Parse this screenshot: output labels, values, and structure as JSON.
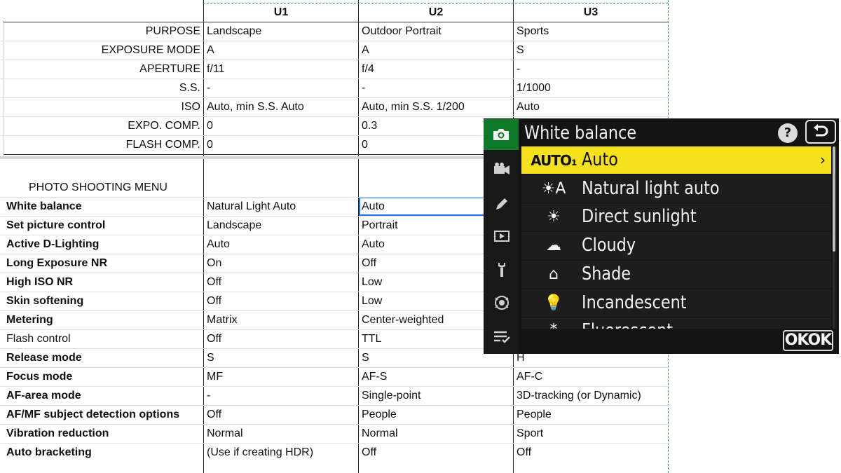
{
  "columns": [
    "U1",
    "U2",
    "U3"
  ],
  "settings_rows": [
    {
      "label": "PURPOSE",
      "u1": "Landscape",
      "u2": "Outdoor Portrait",
      "u3": "Sports"
    },
    {
      "label": "EXPOSURE MODE",
      "u1": "A",
      "u2": "A",
      "u3": "S"
    },
    {
      "label": "APERTURE",
      "u1": "f/11",
      "u2": "f/4",
      "u3": "-"
    },
    {
      "label": "S.S.",
      "u1": "-",
      "u2": "-",
      "u3": "1/1000"
    },
    {
      "label": "ISO",
      "u1": "Auto, min S.S. Auto",
      "u2": "Auto, min S.S. 1/200",
      "u3": "Auto"
    },
    {
      "label": "EXPO. COMP.",
      "u1": "0",
      "u2": "0.3",
      "u3": ""
    },
    {
      "label": "FLASH COMP.",
      "u1": "0",
      "u2": "0",
      "u3": ""
    }
  ],
  "section_title": "PHOTO SHOOTING MENU",
  "menu_rows": [
    {
      "label": "White balance",
      "u1": "Natural Light Auto",
      "u2": "Auto",
      "u3": ""
    },
    {
      "label": "Set picture control",
      "u1": "Landscape",
      "u2": "Portrait",
      "u3": ""
    },
    {
      "label": "Active D-Lighting",
      "u1": "Auto",
      "u2": "Auto",
      "u3": ""
    },
    {
      "label": "Long Exposure NR",
      "u1": "On",
      "u2": "Off",
      "u3": ""
    },
    {
      "label": "High ISO NR",
      "u1": "Off",
      "u2": "Low",
      "u3": ""
    },
    {
      "label": "Skin softening",
      "u1": "Off",
      "u2": "Low",
      "u3": ""
    },
    {
      "label": "Metering",
      "u1": "Matrix",
      "u2": "Center-weighted",
      "u3": ""
    },
    {
      "label": "Flash control",
      "u1": "Off",
      "u2": "TTL",
      "u3": ""
    },
    {
      "label": "Release mode",
      "u1": "S",
      "u2": "S",
      "u3": "H"
    },
    {
      "label": "Focus mode",
      "u1": "MF",
      "u2": "AF-S",
      "u3": "AF-C"
    },
    {
      "label": "AF-area mode",
      "u1": "-",
      "u2": "Single-point",
      "u3": "3D-tracking (or Dynamic)"
    },
    {
      "label": "AF/MF subject detection options",
      "u1": "Off",
      "u2": "People",
      "u3": "People"
    },
    {
      "label": "Vibration reduction",
      "u1": "Normal",
      "u2": "Normal",
      "u3": "Sport"
    },
    {
      "label": "Auto bracketing",
      "u1": "(Use if creating HDR)",
      "u2": "Off",
      "u3": "Off"
    }
  ],
  "camera_menu": {
    "title": "White balance",
    "help": "?",
    "ok_label": "OKOK",
    "items": [
      {
        "icon_text": "AUTO₁",
        "icon": "auto-wb-icon",
        "label": "Auto",
        "highlighted": true
      },
      {
        "icon_text": "☀A",
        "icon": "natural-light-auto-icon",
        "label": "Natural light auto"
      },
      {
        "icon_text": "☀",
        "icon": "sun-icon",
        "label": "Direct sunlight"
      },
      {
        "icon_text": "☁",
        "icon": "cloud-icon",
        "label": "Cloudy"
      },
      {
        "icon_text": "⌂",
        "icon": "shade-house-icon",
        "label": "Shade"
      },
      {
        "icon_text": "💡",
        "icon": "bulb-icon",
        "label": "Incandescent"
      },
      {
        "icon_text": "⁂",
        "icon": "fluorescent-icon",
        "label": "Fluorescent"
      }
    ],
    "highlight_color": "#f6e11d",
    "active_tab_color": "#0e7a2a",
    "tabs": [
      "camera-icon",
      "movie-camera-icon",
      "pencil-icon",
      "playback-icon",
      "wrench-icon",
      "network-icon",
      "my-menu-icon"
    ]
  }
}
